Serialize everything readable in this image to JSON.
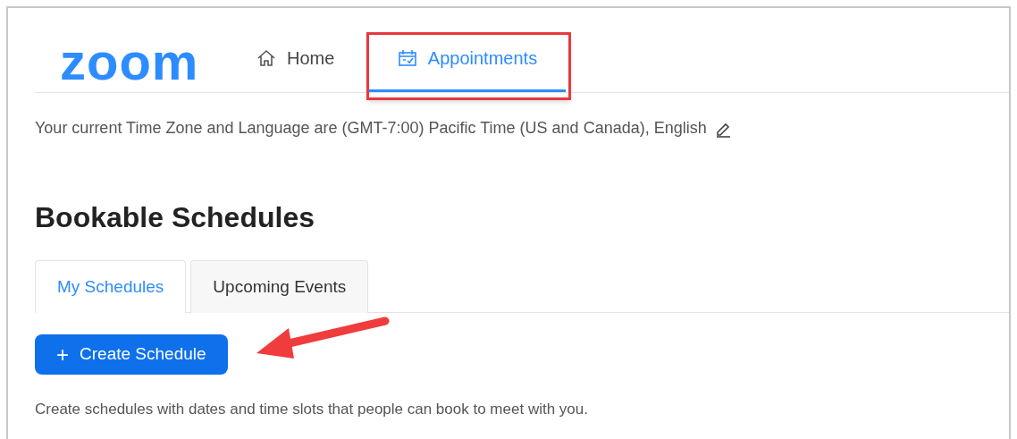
{
  "logo": {
    "text": "zoom"
  },
  "nav": [
    {
      "label": "Home",
      "kind": "home",
      "selected": false
    },
    {
      "label": "Appointments",
      "kind": "calendar",
      "selected": true
    }
  ],
  "timezone_note": "Your current Time Zone and Language are (GMT-7:00) Pacific Time (US and Canada), English",
  "heading": "Bookable Schedules",
  "tabs": [
    {
      "label": "My Schedules",
      "selected": true
    },
    {
      "label": "Upcoming Events",
      "selected": false
    }
  ],
  "create_button": {
    "icon": "+",
    "label": "Create Schedule"
  },
  "description": "Create schedules with dates and time slots that people can book to meet with you.",
  "annotations": {
    "highlight_box": true,
    "pointer_arrow": true
  }
}
